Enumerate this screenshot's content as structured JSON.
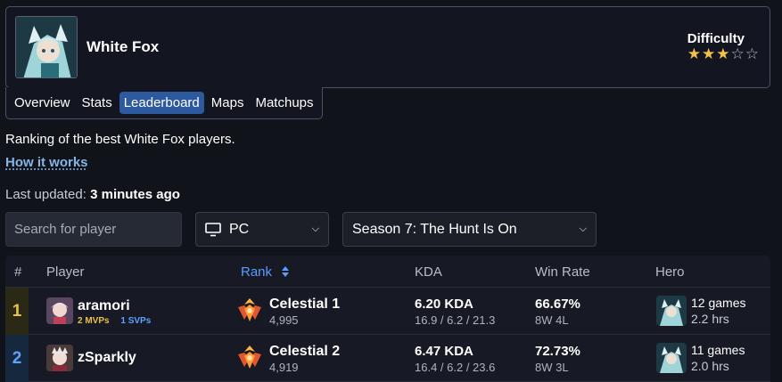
{
  "hero": {
    "name": "White Fox",
    "difficulty_label": "Difficulty",
    "difficulty_stars": 3,
    "difficulty_max": 5
  },
  "tabs": [
    {
      "label": "Overview",
      "active": false
    },
    {
      "label": "Stats",
      "active": false
    },
    {
      "label": "Leaderboard",
      "active": true
    },
    {
      "label": "Maps",
      "active": false
    },
    {
      "label": "Matchups",
      "active": false
    }
  ],
  "page": {
    "description": "Ranking of the best White Fox players.",
    "how_link": "How it works",
    "updated_label": "Last updated:",
    "updated_value": "3 minutes ago"
  },
  "controls": {
    "search_placeholder": "Search for player",
    "platform": "PC",
    "season": "Season 7: The Hunt Is On"
  },
  "table": {
    "headers": {
      "rank_num": "#",
      "player": "Player",
      "rank": "Rank",
      "kda": "KDA",
      "win_rate": "Win Rate",
      "hero": "Hero"
    },
    "rows": [
      {
        "pos": "1",
        "player": "aramori",
        "mvps": "2 MVPs",
        "svps": "1 SVPs",
        "rank": "Celestial 1",
        "score": "4,995",
        "kda": "6.20 KDA",
        "kda_detail": "16.9 / 6.2 / 21.3",
        "win_rate": "66.67%",
        "wl": "8W 4L",
        "games": "12 games",
        "hours": "2.2 hrs"
      },
      {
        "pos": "2",
        "player": "zSparkly",
        "mvps": "",
        "svps": "",
        "rank": "Celestial 2",
        "score": "4,919",
        "kda": "6.47 KDA",
        "kda_detail": "16.4 / 6.2 / 23.6",
        "win_rate": "72.73%",
        "wl": "8W 3L",
        "games": "11 games",
        "hours": "2.0 hrs"
      }
    ]
  },
  "colors": {
    "accent": "#2d5a9e",
    "gold": "#e9c04a",
    "blue": "#5ba3ff",
    "link": "#86b4e8",
    "star": "#f2c14e"
  }
}
